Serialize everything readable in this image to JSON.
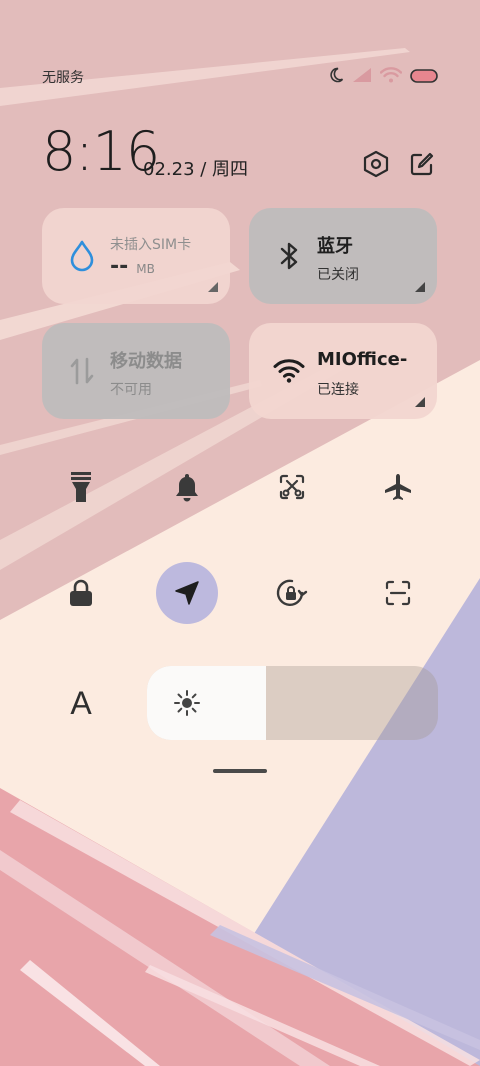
{
  "status_bar": {
    "carrier": "无服务"
  },
  "header": {
    "time": "8:16",
    "date": "02.23 / 周四"
  },
  "tiles": [
    {
      "title": "未插入SIM卡",
      "value": "--",
      "unit": "MB",
      "icon": "water-drop-icon",
      "state": "disabled"
    },
    {
      "title": "蓝牙",
      "subtitle": "已关闭",
      "icon": "bluetooth-icon",
      "state": "off"
    },
    {
      "title": "移动数据",
      "subtitle": "不可用",
      "icon": "mobile-data-icon",
      "state": "unavailable"
    },
    {
      "title": "MIOffice-",
      "subtitle": "已连接",
      "icon": "wifi-icon",
      "state": "on"
    }
  ],
  "toggles_row1": [
    {
      "name": "flashlight",
      "icon": "flashlight-icon",
      "active": false
    },
    {
      "name": "notifications",
      "icon": "bell-icon",
      "active": false
    },
    {
      "name": "screenshot",
      "icon": "screenshot-icon",
      "active": false
    },
    {
      "name": "airplane-mode",
      "icon": "airplane-icon",
      "active": false
    }
  ],
  "toggles_row2": [
    {
      "name": "lock-screen",
      "icon": "lock-icon",
      "active": false
    },
    {
      "name": "location",
      "icon": "location-arrow-icon",
      "active": true
    },
    {
      "name": "rotation-lock",
      "icon": "rotation-lock-icon",
      "active": false
    },
    {
      "name": "scanner",
      "icon": "scan-icon",
      "active": false
    }
  ],
  "font_button": {
    "label": "A"
  },
  "brightness": {
    "level": 0.41,
    "icon": "sun-icon"
  },
  "colors": {
    "accent_active": "#bdb9de",
    "tile_pink": "#f0cfca",
    "tile_gray": "#bdbcbc",
    "water_blue": "#2f8fdc"
  }
}
